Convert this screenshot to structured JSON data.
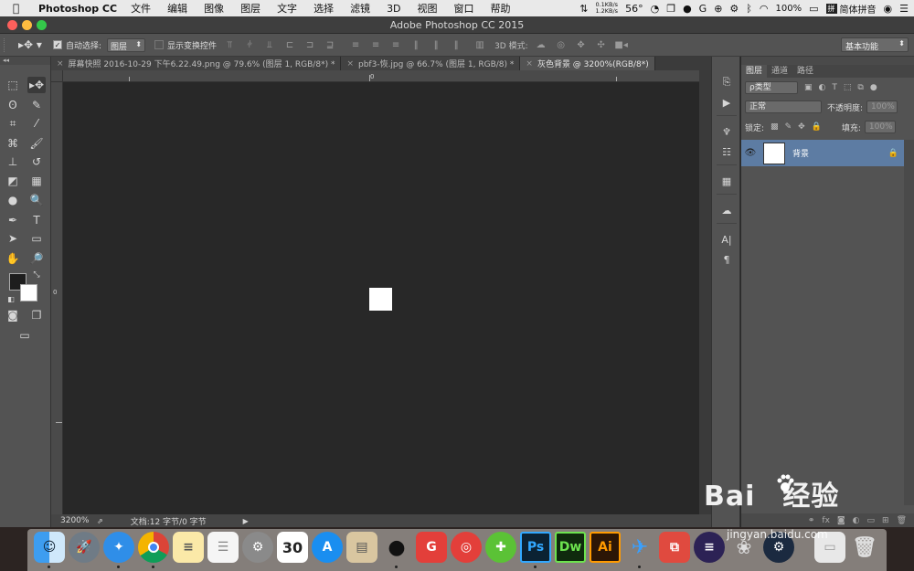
{
  "menubar": {
    "app_name": "Photoshop CC",
    "menus": [
      "文件",
      "编辑",
      "图像",
      "图层",
      "文字",
      "选择",
      "滤镜",
      "3D",
      "视图",
      "窗口",
      "帮助"
    ],
    "net_up": "0.1KB/s",
    "net_down": "1.2KB/s",
    "temperature": "56°",
    "battery": "100%",
    "input_method": "简体拼音"
  },
  "window": {
    "title": "Adobe Photoshop CC 2015"
  },
  "options_bar": {
    "auto_select_label": "自动选择:",
    "auto_select_target": "图层",
    "show_transform_label": "显示变换控件",
    "mode_3d_label": "3D 模式:",
    "workspace": "基本功能"
  },
  "tabs": [
    {
      "label": "屏幕快照 2016-10-29 下午6.22.49.png @ 79.6% (图层 1, RGB/8*) *",
      "active": false
    },
    {
      "label": "pbf3-恢.jpg @ 66.7% (图层 1, RGB/8) *",
      "active": false
    },
    {
      "label": "灰色背景 @ 3200%(RGB/8*)",
      "active": true
    }
  ],
  "rulers": {
    "top_zero": "0",
    "left_zero": "0"
  },
  "status": {
    "zoom": "3200%",
    "doc_info": "文档:12 字节/0 字节"
  },
  "layers_panel": {
    "tabs": [
      "图层",
      "通道",
      "路径"
    ],
    "filter_kind": "ρ类型",
    "blend_mode": "正常",
    "opacity_label": "不透明度:",
    "opacity_value": "100%",
    "lock_label": "锁定:",
    "fill_label": "填充:",
    "fill_value": "100%",
    "layers": [
      {
        "name": "背景",
        "locked": true,
        "visible": true
      }
    ]
  },
  "dock": {
    "calendar_day": "30",
    "apps": [
      "Finder",
      "Launchpad",
      "Safari",
      "Chrome",
      "Notes",
      "Reminders",
      "System Preferences",
      "Calendar",
      "App Store",
      "Preview",
      "QQ",
      "NetEase",
      "NetEase Music",
      "Add",
      "Ps",
      "Dw",
      "Ai",
      "Feiyu",
      "Tool",
      "Eclipse",
      "Pin",
      "Steam",
      "Finder Window",
      "Trash"
    ]
  },
  "watermark": {
    "brand": "Bai",
    "brand_suffix": "经验",
    "url": "jingyan.baidu.com"
  }
}
